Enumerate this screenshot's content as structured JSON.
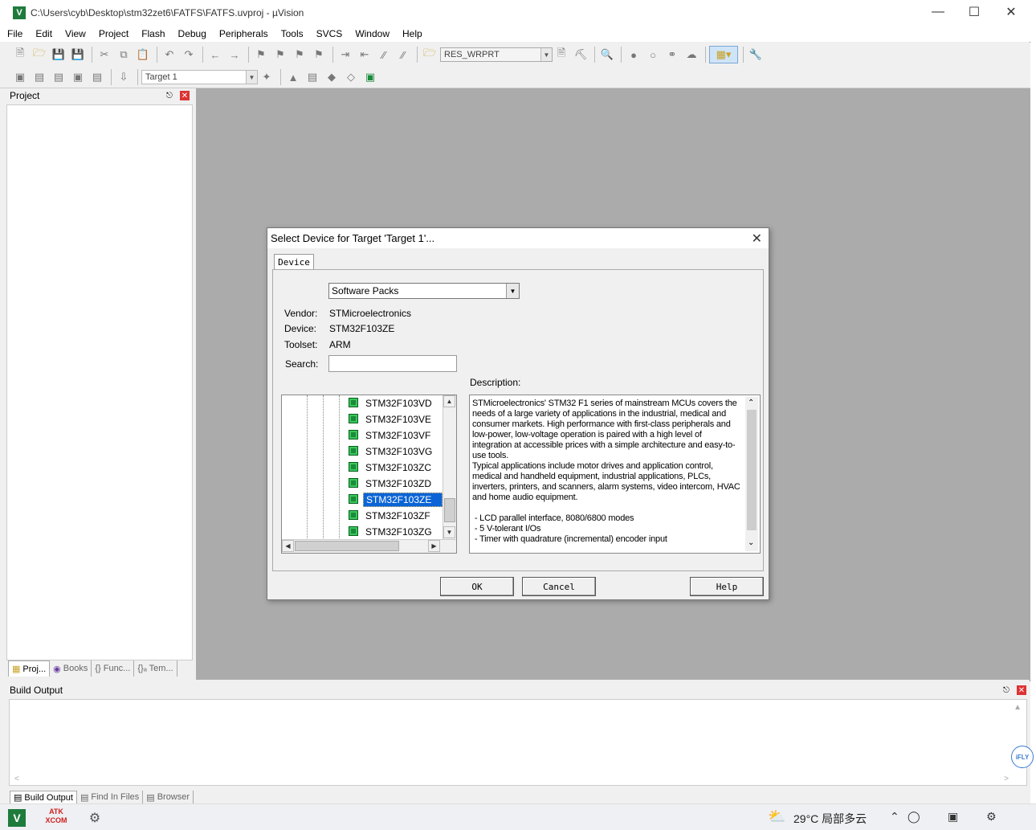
{
  "window": {
    "title": "C:\\Users\\cyb\\Desktop\\stm32zet6\\FATFS\\FATFS.uvproj - µVision",
    "logo": "V"
  },
  "menu": [
    "File",
    "Edit",
    "View",
    "Project",
    "Flash",
    "Debug",
    "Peripherals",
    "Tools",
    "SVCS",
    "Window",
    "Help"
  ],
  "toolbar": {
    "find_combo": "RES_WRPRT",
    "target_combo": "Target 1"
  },
  "project_panel": {
    "title": "Project",
    "tabs": [
      "Proj...",
      "Books",
      "{} Func...",
      "{}ₐ Tem..."
    ]
  },
  "build_panel": {
    "title": "Build Output",
    "tabs": [
      "Build Output",
      "Find In Files",
      "Browser"
    ]
  },
  "dialog": {
    "title": "Select Device for Target 'Target 1'...",
    "tab": "Device",
    "packs_combo": "Software Packs",
    "vendor_label": "Vendor:",
    "vendor": "STMicroelectronics",
    "device_label": "Device:",
    "device": "STM32F103ZE",
    "toolset_label": "Toolset:",
    "toolset": "ARM",
    "search_label": "Search:",
    "search_value": "",
    "description_label": "Description:",
    "devices": [
      "STM32F103VD",
      "STM32F103VE",
      "STM32F103VF",
      "STM32F103VG",
      "STM32F103ZC",
      "STM32F103ZD",
      "STM32F103ZE",
      "STM32F103ZF",
      "STM32F103ZG"
    ],
    "selected_device": "STM32F103ZE",
    "description": "STMicroelectronics' STM32 F1 series of mainstream MCUs covers the\nneeds of a large variety of applications in the industrial, medical and\nconsumer markets. High performance with first-class peripherals and\nlow-power, low-voltage operation is paired with a high level of\nintegration at accessible prices with a simple architecture and easy-to-\nuse tools.\nTypical applications include motor drives and application control,\nmedical and handheld equipment, industrial applications, PLCs,\ninverters, printers, and scanners, alarm systems, video intercom, HVAC\nand home audio equipment.\n\n - LCD parallel interface, 8080/6800 modes\n - 5 V-tolerant I/Os\n - Timer with quadrature (incremental) encoder input",
    "buttons": {
      "ok": "OK",
      "cancel": "Cancel",
      "help": "Help"
    }
  },
  "taskbar": {
    "atk_line1": "ATK",
    "atk_line2": "XCOM",
    "weather": "29°C  局部多云",
    "side_badge": "iFLY"
  },
  "colors": {
    "selection": "#0a64d6",
    "chip": "#1b8a3a",
    "main_bg": "#ababab"
  }
}
